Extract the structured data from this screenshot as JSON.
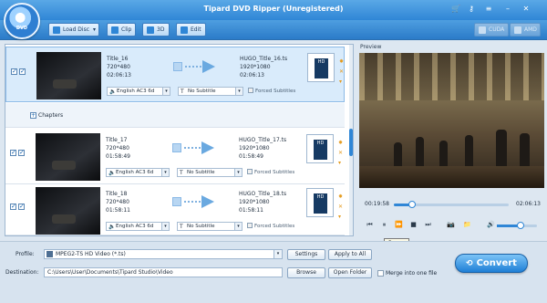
{
  "window": {
    "title": "Tipard DVD Ripper (Unregistered)",
    "logo_text": "DVD"
  },
  "toolbar": {
    "load_disc": "Load Disc",
    "clip": "Clip",
    "threed": "3D",
    "edit": "Edit",
    "cuda": "CUDA",
    "amd": "AMD"
  },
  "titles": [
    {
      "name": "Title_16",
      "resolution": "720*480",
      "duration": "02:06:13",
      "output_name": "HUGO_Title_16.ts",
      "output_resolution": "1920*1080",
      "output_duration": "02:06:13",
      "audio": "English AC3 6d",
      "subtitle": "No Subtitle",
      "forced": "Forced Subtitles",
      "selected": true
    },
    {
      "name": "Title_17",
      "resolution": "720*480",
      "duration": "01:58:49",
      "output_name": "HUGO_Title_17.ts",
      "output_resolution": "1920*1080",
      "output_duration": "01:58:49",
      "audio": "English AC3 6d",
      "subtitle": "No Subtitle",
      "forced": "Forced Subtitles",
      "selected": false
    },
    {
      "name": "Title_18",
      "resolution": "720*480",
      "duration": "01:58:11",
      "output_name": "HUGO_Title_18.ts",
      "output_resolution": "1920*1080",
      "output_duration": "01:58:11",
      "audio": "English AC3 6d",
      "subtitle": "No Subtitle",
      "forced": "Forced Subtitles",
      "selected": false
    }
  ],
  "chapters_label": "Chapters",
  "preview": {
    "label": "Preview",
    "current_time": "00:19:58",
    "total_time": "02:06:13",
    "progress": 0.16,
    "volume": 0.6,
    "tooltip": "Pause"
  },
  "bottom": {
    "profile_label": "Profile:",
    "profile_value": "MPEG2-TS HD Video (*.ts)",
    "settings": "Settings",
    "apply_all": "Apply to All",
    "destination_label": "Destination:",
    "destination_value": "C:\\Users\\User\\Documents\\Tipard Studio\\Video",
    "browse": "Browse",
    "open_folder": "Open Folder",
    "merge": "Merge into one file",
    "convert": "Convert"
  },
  "colors": {
    "accent": "#2f86d6",
    "selected_row": "#d9ebfb"
  }
}
